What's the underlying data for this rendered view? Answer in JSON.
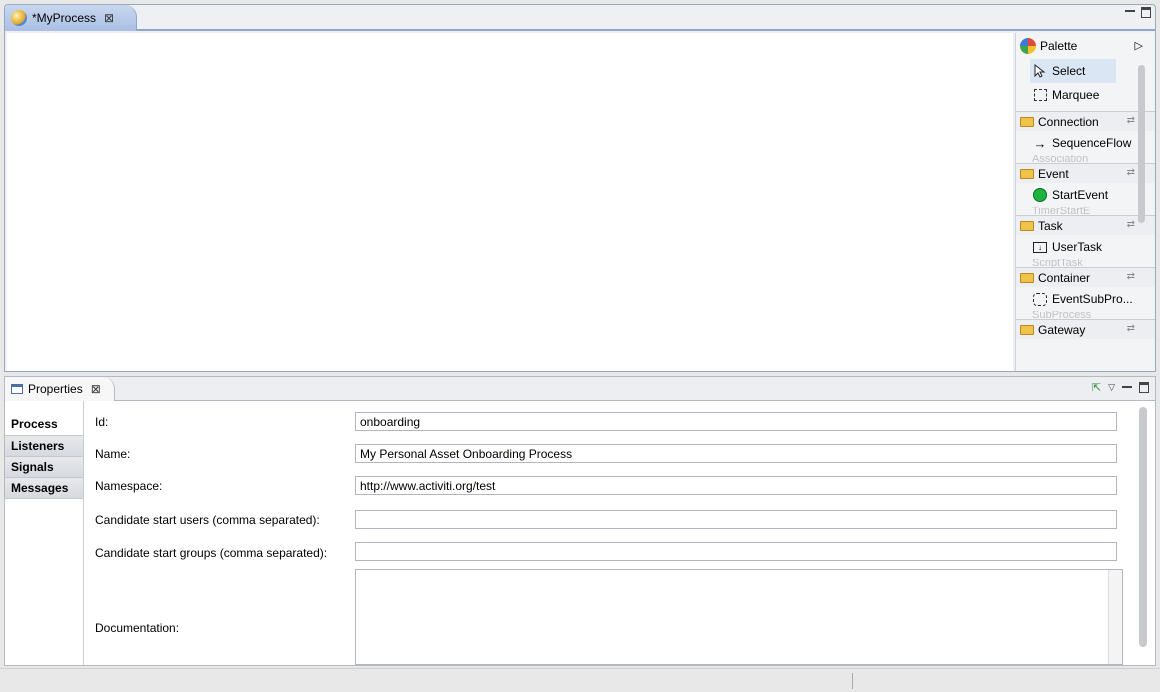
{
  "editor": {
    "tab_title": "*MyProcess",
    "close_glyph": "⊠"
  },
  "palette": {
    "title": "Palette",
    "collapse_glyph": "▷",
    "tools": [
      {
        "label": "Select",
        "icon": "cursor-arrow-icon"
      },
      {
        "label": "Marquee",
        "icon": "marquee-icon"
      }
    ],
    "drawers": [
      {
        "label": "Connection",
        "items": [
          "SequenceFlow"
        ],
        "faded": "Association"
      },
      {
        "label": "Event",
        "items": [
          "StartEvent"
        ],
        "faded": "TimerStartE"
      },
      {
        "label": "Task",
        "items": [
          "UserTask"
        ],
        "faded": "ScriptTask"
      },
      {
        "label": "Container",
        "items": [
          "EventSubPro..."
        ],
        "faded": "SubProcess"
      },
      {
        "label": "Gateway",
        "items": [],
        "faded": ""
      }
    ]
  },
  "properties": {
    "view_title": "Properties",
    "close_glyph": "⊠",
    "side_tabs": [
      "Process",
      "Listeners",
      "Signals",
      "Messages"
    ],
    "fields": [
      {
        "label": "Id:",
        "value": "onboarding"
      },
      {
        "label": "Name:",
        "value": "My Personal Asset Onboarding Process"
      },
      {
        "label": "Namespace:",
        "value": "http://www.activiti.org/test"
      },
      {
        "label": "Candidate start users (comma separated):",
        "value": ""
      },
      {
        "label": "Candidate start groups (comma separated):",
        "value": ""
      }
    ],
    "documentation_label": "Documentation:",
    "documentation_value": ""
  },
  "colors": {
    "editor_tab": "#b6c8e9",
    "start_event": "#1eb33f"
  }
}
